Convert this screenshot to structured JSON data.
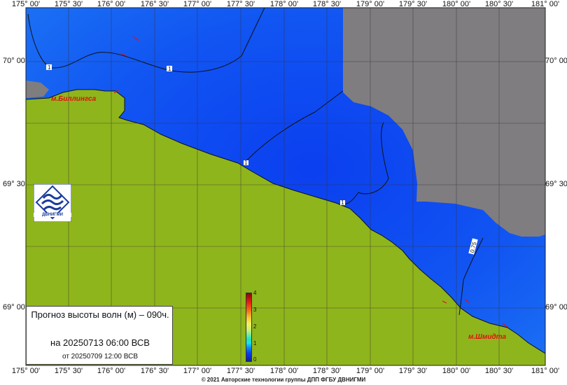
{
  "map": {
    "lon_labels": [
      "175° 00'",
      "175° 30'",
      "176° 00'",
      "176° 30'",
      "177° 00'",
      "177° 30'",
      "178° 00'",
      "178° 30'",
      "179° 00'",
      "179° 30'",
      "180° 00'",
      "180° 30'",
      "181° 00'"
    ],
    "lat_labels": [
      "70° 00'",
      "69° 30'",
      "69° 00'"
    ],
    "places": {
      "billings": "м.Биллингса",
      "schmidt": "м.Шмидта"
    },
    "contour_labels": [
      "1",
      "1",
      "1",
      "1",
      "1",
      "0.75",
      "1"
    ],
    "colors": {
      "land": "#8fb51c",
      "no_data": "#7f7d80",
      "sea_deep": "#0b3ff0",
      "sea_light": "#1a66f2"
    }
  },
  "info": {
    "title": "Прогноз высоты волн (м) – 090ч.",
    "date": "на 20250713 06:00 ВСВ",
    "issued": "от 20250709 12:00 ВСВ"
  },
  "colorbar": {
    "ticks": [
      "4",
      "3",
      "2",
      "1",
      "0"
    ]
  },
  "logo": {
    "text": "ДВНИГМИ"
  },
  "footer": {
    "copyright": "© 2021 Авторские технологии группы ДПП ФГБУ ДВНИГМИ"
  }
}
